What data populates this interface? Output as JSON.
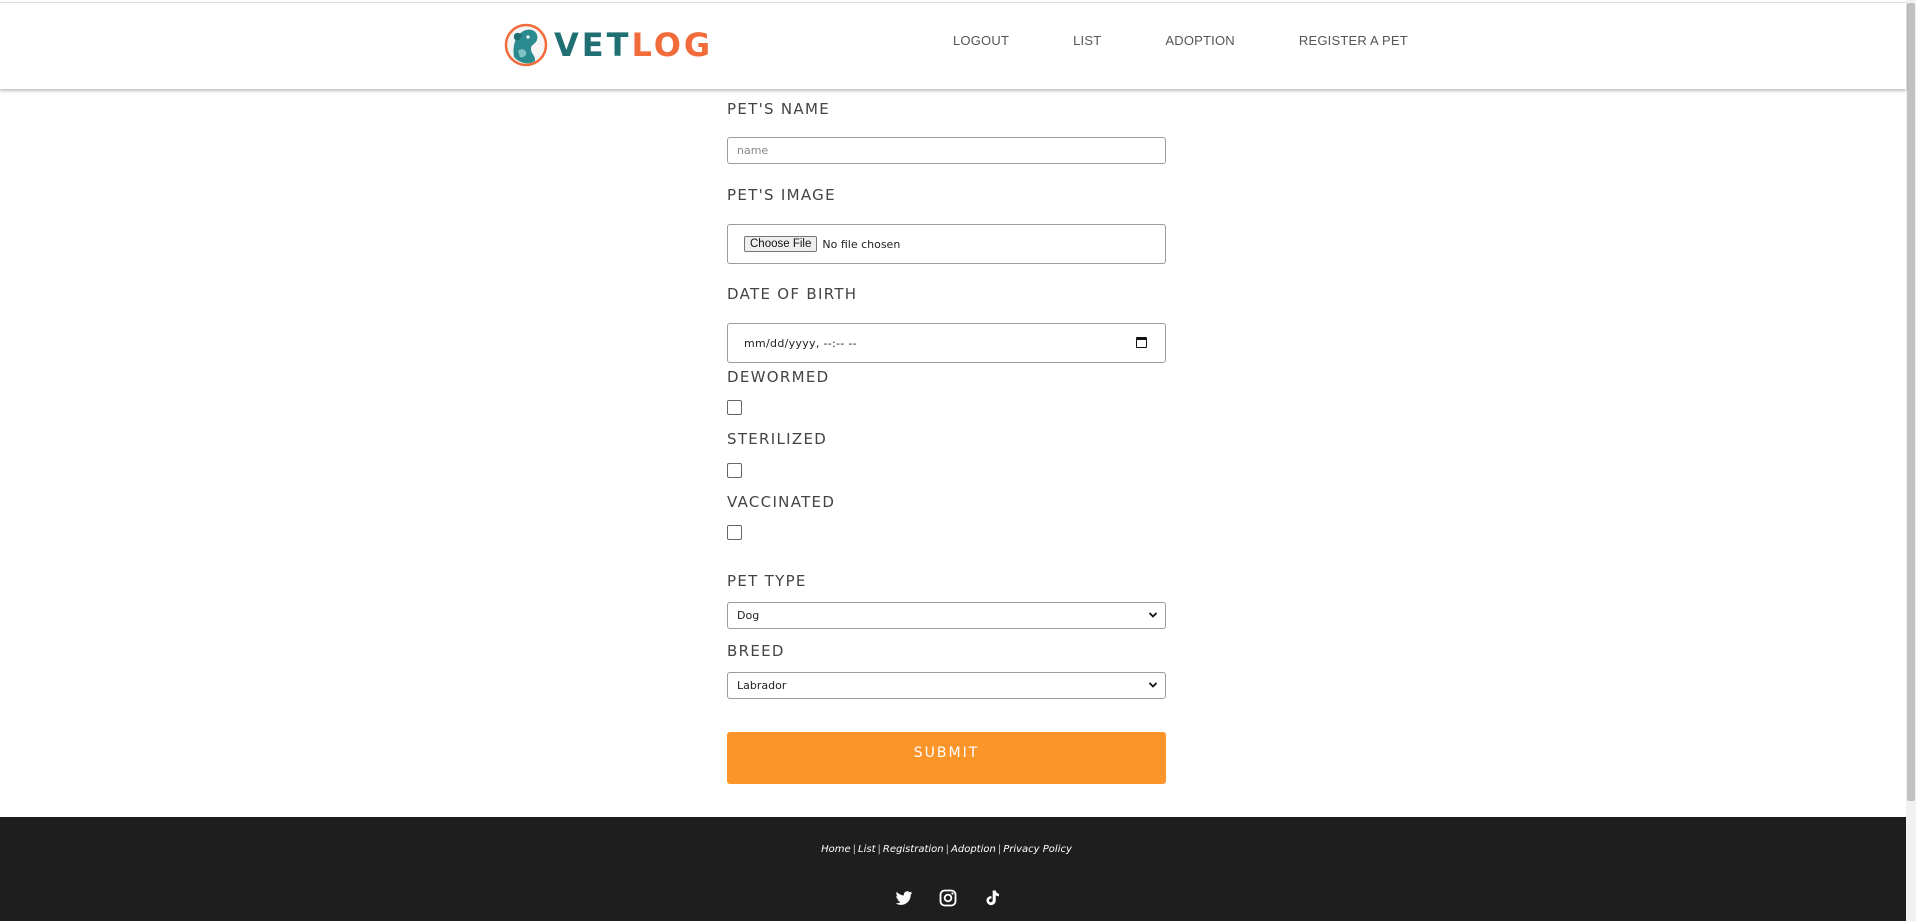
{
  "brand": {
    "part1": "VET",
    "part2": "LOG",
    "color_primary": "#1f6f73",
    "color_secondary": "#f26b3a"
  },
  "nav": {
    "items": [
      "LOGOUT",
      "LIST",
      "ADOPTION",
      "REGISTER A PET"
    ]
  },
  "form": {
    "name_label": "PET'S NAME",
    "name_placeholder": "name",
    "image_label": "PET'S IMAGE",
    "file_button": "Choose File",
    "file_status": "No file chosen",
    "dob_label": "DATE OF BIRTH",
    "dob_placeholder": "mm/dd/yyyy, --:-- --",
    "dewormed_label": "DEWORMED",
    "dewormed_checked": false,
    "sterilized_label": "STERILIZED",
    "sterilized_checked": false,
    "vaccinated_label": "VACCINATED",
    "vaccinated_checked": false,
    "pet_type_label": "PET TYPE",
    "pet_type_value": "Dog",
    "breed_label": "BREED",
    "breed_value": "Labrador",
    "submit_label": "SUBMIT",
    "submit_color": "#fb952a"
  },
  "footer": {
    "links": [
      "Home",
      "List",
      "Registration",
      "Adoption",
      "Privacy Policy"
    ],
    "separator": "|",
    "social_icons": [
      "twitter-icon",
      "instagram-icon",
      "tiktok-icon"
    ]
  }
}
